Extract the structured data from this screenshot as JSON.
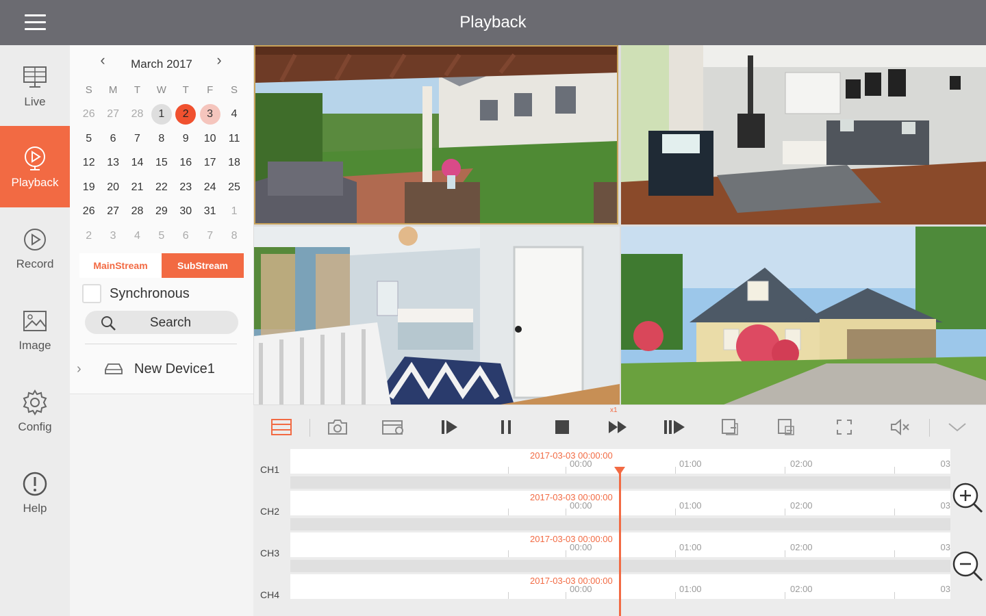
{
  "header": {
    "title": "Playback",
    "menu_icon": "hamburger-menu-icon"
  },
  "nav": {
    "items": [
      {
        "label": "Live",
        "icon": "monitor-icon",
        "active": false
      },
      {
        "label": "Playback",
        "icon": "play-circle-icon",
        "active": true
      },
      {
        "label": "Record",
        "icon": "record-icon",
        "active": false
      },
      {
        "label": "Image",
        "icon": "image-icon",
        "active": false
      },
      {
        "label": "Config",
        "icon": "gear-icon",
        "active": false
      },
      {
        "label": "Help",
        "icon": "help-icon",
        "active": false
      }
    ]
  },
  "calendar": {
    "month": "March 2017",
    "weekdays": [
      "S",
      "M",
      "T",
      "W",
      "T",
      "F",
      "S"
    ],
    "weeks": [
      [
        "26",
        "27",
        "28",
        "1",
        "2",
        "3",
        "4"
      ],
      [
        "5",
        "6",
        "7",
        "8",
        "9",
        "10",
        "11"
      ],
      [
        "12",
        "13",
        "14",
        "15",
        "16",
        "17",
        "18"
      ],
      [
        "19",
        "20",
        "21",
        "22",
        "23",
        "24",
        "25"
      ],
      [
        "26",
        "27",
        "28",
        "29",
        "30",
        "31",
        "1"
      ],
      [
        "2",
        "3",
        "4",
        "5",
        "6",
        "7",
        "8"
      ]
    ],
    "selected_day": "2",
    "days_with_recordings": [
      "1",
      "3"
    ]
  },
  "streams": {
    "main_label": "MainStream",
    "sub_label": "SubStream",
    "active": "SubStream"
  },
  "sync": {
    "label": "Synchronous",
    "checked": false
  },
  "search": {
    "label": "Search"
  },
  "device": {
    "name": "New Device1"
  },
  "cameras": [
    {
      "scene": "patio"
    },
    {
      "scene": "living-room"
    },
    {
      "scene": "bedroom"
    },
    {
      "scene": "house-exterior"
    }
  ],
  "toolbar": {
    "buttons": [
      "split-layout-icon",
      "snapshot-icon",
      "record-clip-icon",
      "play-icon",
      "pause-icon",
      "stop-icon",
      "fast-forward-icon",
      "frame-step-icon",
      "copy-icon",
      "copy-all-icon",
      "fullscreen-icon",
      "mute-icon",
      "collapse-chevron-icon"
    ],
    "speed_label": "x1"
  },
  "timeline": {
    "channels": [
      {
        "label": "CH1",
        "date": "2017-03-03 00:00:00"
      },
      {
        "label": "CH2",
        "date": "2017-03-03 00:00:00"
      },
      {
        "label": "CH3",
        "date": "2017-03-03 00:00:00"
      },
      {
        "label": "CH4",
        "date": "2017-03-03 00:00:00"
      }
    ],
    "time_labels": [
      "00:00",
      "01:00",
      "02:00",
      "03"
    ],
    "zoom_in_icon": "zoom-in-icon",
    "zoom_out_icon": "zoom-out-icon"
  },
  "colors": {
    "accent": "#f26a43",
    "header": "#6b6b71",
    "selected_day": "#f0512f"
  }
}
